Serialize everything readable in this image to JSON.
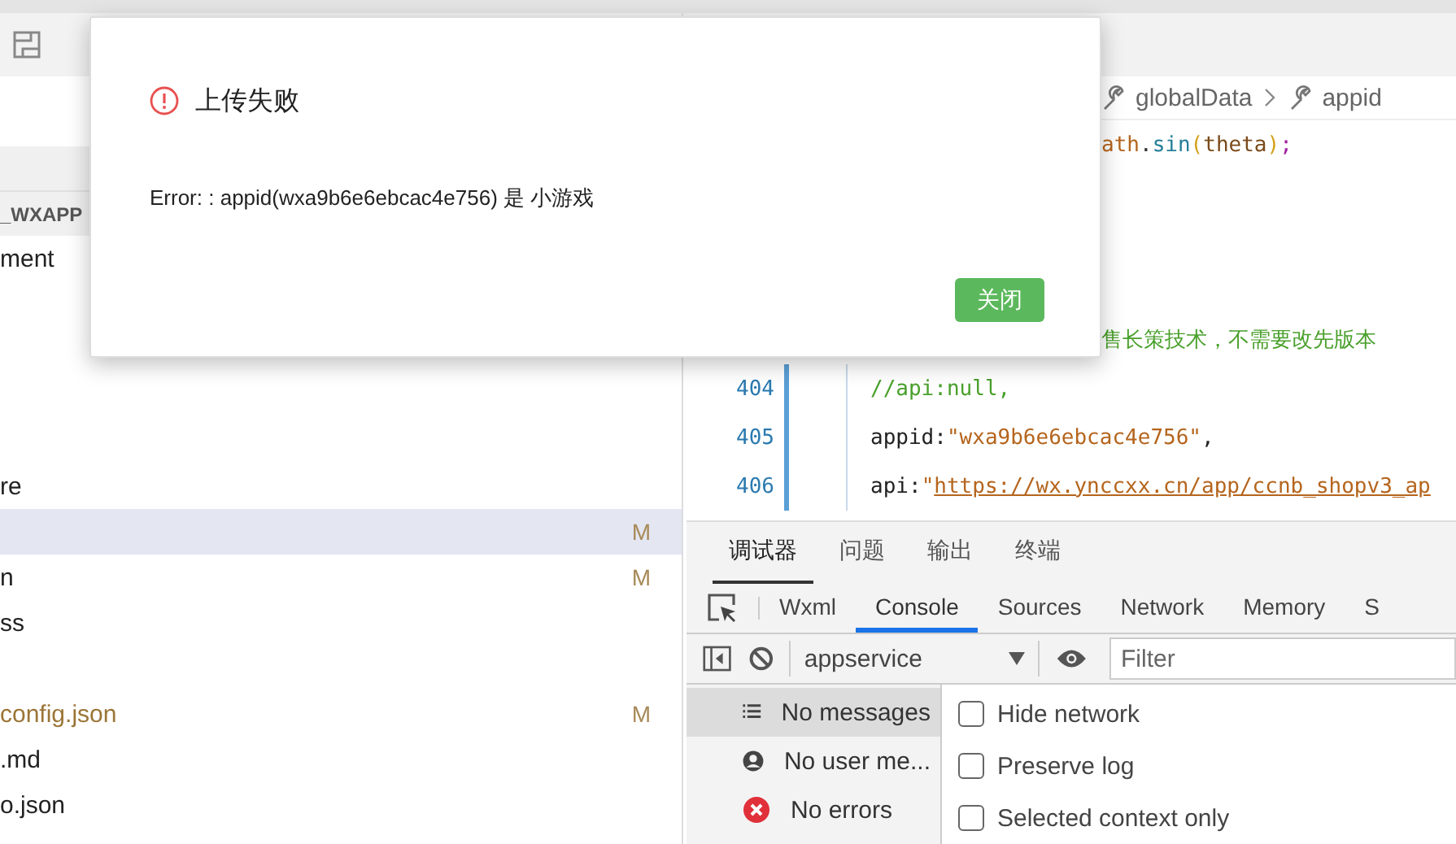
{
  "explorer": {
    "project": "_WXAPP",
    "files": [
      {
        "name": "ment",
        "selected": false
      },
      {
        "name": "re",
        "selected": false
      },
      {
        "selected": true,
        "badge": "M"
      },
      {
        "name": "n",
        "selected": false,
        "badge": "M"
      },
      {
        "name": "ss",
        "selected": false
      },
      {
        "name": "config.json",
        "selected": false,
        "badge": "M",
        "color": "#9b7536"
      },
      {
        "name": ".md",
        "selected": false
      },
      {
        "name": "o.json",
        "selected": false
      }
    ]
  },
  "breadcrumb": [
    "globalData",
    "appid"
  ],
  "code": [
    {
      "tokens": [
        {
          "kind": "fn",
          "text": "ath"
        },
        {
          "kind": "punct",
          "text": "."
        },
        {
          "kind": "method",
          "text": "sin"
        },
        {
          "kind": "paren",
          "text": "("
        },
        {
          "kind": "var",
          "text": "theta"
        },
        {
          "kind": "paren",
          "text": ")"
        },
        {
          "kind": "semi",
          "text": ";"
        }
      ]
    },
    {
      "tokens": [
        {
          "kind": "comment",
          "text": "售长策技术，不需要改先版本"
        }
      ]
    },
    {
      "number": "404",
      "tokens": [
        {
          "kind": "comment",
          "text": "//api:null,"
        }
      ]
    },
    {
      "number": "405",
      "tokens": [
        {
          "kind": "plain",
          "text": "appid:"
        },
        {
          "kind": "string",
          "text": "\"wxa9b6e6ebcac4e756\""
        },
        {
          "kind": "plain",
          "text": ","
        }
      ]
    },
    {
      "number": "406",
      "tokens": [
        {
          "kind": "plain",
          "text": "api:"
        },
        {
          "kind": "string",
          "text": "\""
        },
        {
          "kind": "link",
          "text": "https://wx.ynccxx.cn/app/ccnb_shopv3_ap"
        }
      ]
    }
  ],
  "panel_tabs": [
    {
      "label": "调试器",
      "selected": true
    },
    {
      "label": "问题",
      "selected": false
    },
    {
      "label": "输出",
      "selected": false
    },
    {
      "label": "终端",
      "selected": false
    }
  ],
  "devtools_tabs": [
    {
      "label": "Wxml",
      "selected": false
    },
    {
      "label": "Console",
      "selected": true
    },
    {
      "label": "Sources",
      "selected": false
    },
    {
      "label": "Network",
      "selected": false
    },
    {
      "label": "Memory",
      "selected": false
    },
    {
      "label": "S",
      "selected": false
    }
  ],
  "console": {
    "context": "appservice",
    "filter_placeholder": "Filter",
    "sidebar": [
      {
        "kind": "messages",
        "label": "No messages",
        "selected": true
      },
      {
        "kind": "user",
        "label": "No user me...",
        "selected": false
      },
      {
        "kind": "errors",
        "label": "No errors",
        "selected": false
      }
    ],
    "options": [
      {
        "label": "Hide network",
        "checked": false
      },
      {
        "label": "Preserve log",
        "checked": false
      },
      {
        "label": "Selected context only",
        "checked": false
      }
    ]
  },
  "dialog": {
    "title": "上传失败",
    "message": "Error: : appid(wxa9b6e6ebcac4e756) 是 小游戏",
    "button": "关闭"
  }
}
